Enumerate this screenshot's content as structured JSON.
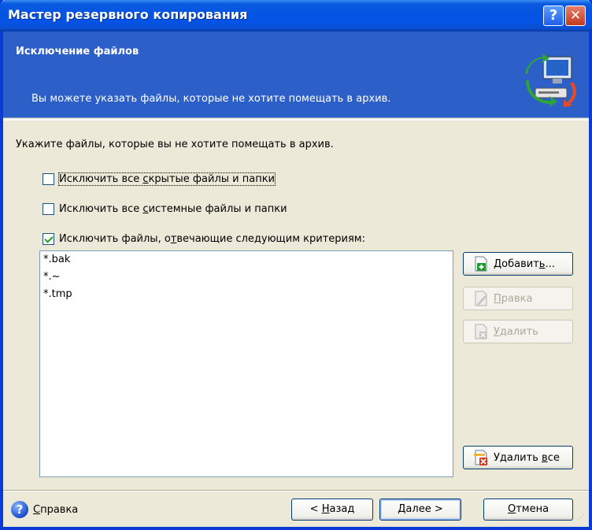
{
  "window": {
    "title": "Мастер резервного копирования",
    "help_glyph": "?",
    "close_glyph": "✕"
  },
  "header": {
    "title": "Исключение файлов",
    "subtitle": "Вы можете указать файлы, которые не хотите помещать в архив."
  },
  "content": {
    "prompt": "Укажите файлы, которые вы не хотите помещать в архив.",
    "options": [
      {
        "pre": "Исключить все ",
        "ul": "с",
        "post": "крытые файлы и папки",
        "checked": false
      },
      {
        "pre": "Исключить все ",
        "ul": "с",
        "post": "истемные файлы и папки",
        "checked": false
      },
      {
        "pre": "Исключить файлы, о",
        "ul": "т",
        "post": "вечающие следующим критериям:",
        "checked": true
      }
    ],
    "list_items": [
      "*.bak",
      "*.~",
      "*.tmp"
    ]
  },
  "side_buttons": {
    "add_pre": "Добавит",
    "add_ul": "ь",
    "add_post": "...",
    "edit_pre": "",
    "edit_ul": "П",
    "edit_post": "равка",
    "delete_pre": "",
    "delete_ul": "У",
    "delete_post": "далить",
    "delete_all_pre": "Удалить ",
    "delete_all_ul": "в",
    "delete_all_post": "се"
  },
  "footer": {
    "help_pre": "",
    "help_ul": "С",
    "help_post": "правка",
    "back_pre": "< ",
    "back_ul": "Н",
    "back_post": "азад",
    "next_pre": "",
    "next_ul": "Д",
    "next_post": "алее >",
    "cancel_pre": "",
    "cancel_ul": "О",
    "cancel_post": "тмена"
  },
  "colors": {
    "title_bar": "#0554e3",
    "header_bg": "#2d5fc8",
    "dialog_bg": "#ece9d8",
    "check_mark": "#21a121"
  },
  "icons": {
    "header": "computer-backup-icon",
    "add": "add-doc-icon",
    "edit": "edit-doc-icon",
    "delete": "delete-doc-icon",
    "delete_all": "delete-all-icon",
    "help": "help-icon"
  }
}
